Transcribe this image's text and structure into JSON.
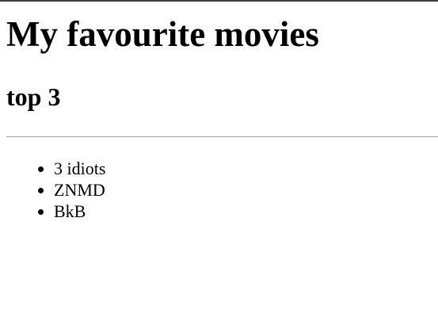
{
  "page": {
    "title": "My favourite movies",
    "subtitle": "top 3"
  },
  "movies": [
    {
      "name": "3 idiots"
    },
    {
      "name": "ZNMD"
    },
    {
      "name": "BkB"
    }
  ]
}
